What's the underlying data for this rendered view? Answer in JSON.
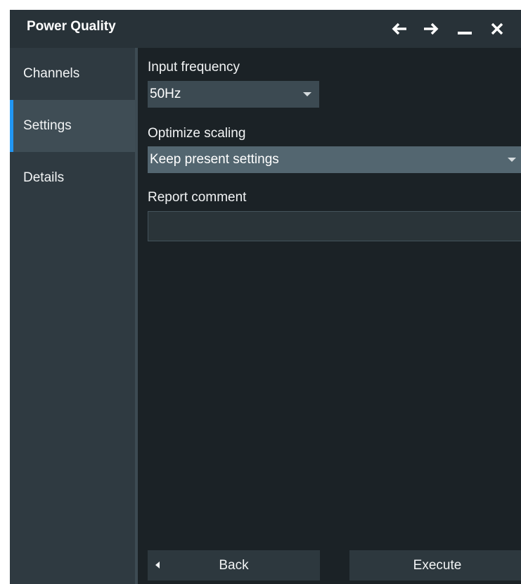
{
  "window": {
    "title": "Power Quality",
    "icons": [
      "back-arrow-icon",
      "forward-arrow-icon",
      "minimize-icon",
      "close-icon"
    ]
  },
  "sidebar": {
    "items": [
      {
        "label": "Channels",
        "active": false
      },
      {
        "label": "Settings",
        "active": true
      },
      {
        "label": "Details",
        "active": false
      }
    ]
  },
  "settings": {
    "input_frequency": {
      "label": "Input frequency",
      "value": "50Hz"
    },
    "optimize_scaling": {
      "label": "Optimize scaling",
      "value": "Keep present settings"
    },
    "report_comment": {
      "label": "Report comment",
      "value": ""
    }
  },
  "footer": {
    "back_label": "Back",
    "execute_label": "Execute"
  },
  "colors": {
    "accent": "#2196f3",
    "background": "#1b2226",
    "sidebar": "#2f3a41",
    "titlebar": "#283238"
  }
}
